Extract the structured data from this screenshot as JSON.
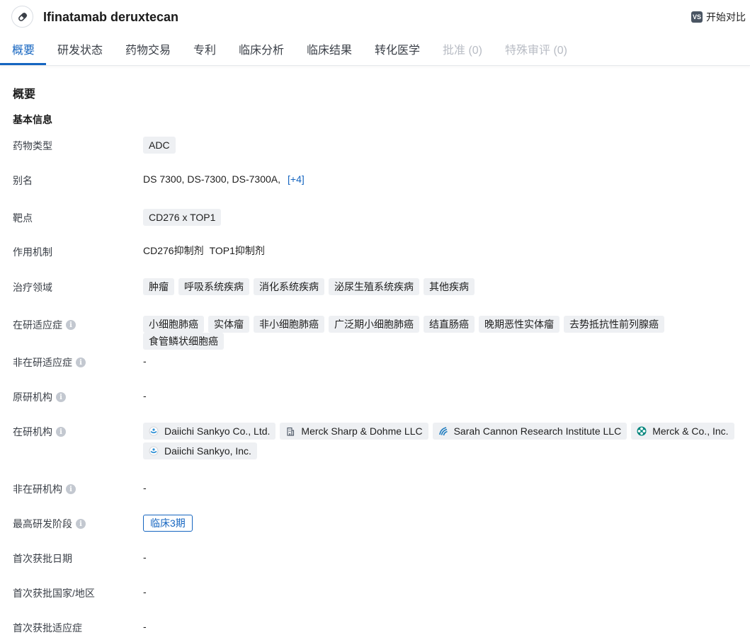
{
  "header": {
    "drug_name": "Ifinatamab deruxtecan",
    "compare_badge": "VS",
    "compare_label": "开始对比"
  },
  "tabs": [
    {
      "label": "概要",
      "state": "active"
    },
    {
      "label": "研发状态",
      "state": "normal"
    },
    {
      "label": "药物交易",
      "state": "normal"
    },
    {
      "label": "专利",
      "state": "normal"
    },
    {
      "label": "临床分析",
      "state": "normal"
    },
    {
      "label": "临床结果",
      "state": "normal"
    },
    {
      "label": "转化医学",
      "state": "normal"
    },
    {
      "label": "批准 (0)",
      "state": "disabled"
    },
    {
      "label": "特殊审评 (0)",
      "state": "disabled"
    }
  ],
  "section_title": "概要",
  "basic_info_title": "基本信息",
  "info_icon_glyph": "i",
  "rows": {
    "drug_type": {
      "label": "药物类型",
      "tags": [
        "ADC"
      ]
    },
    "aliases": {
      "label": "别名",
      "values": [
        "DS 7300,",
        "DS-7300,",
        "DS-7300A,"
      ],
      "more": "[+4]"
    },
    "target": {
      "label": "靶点",
      "tags": [
        "CD276 x TOP1"
      ]
    },
    "mechanism": {
      "label": "作用机制",
      "values": [
        "CD276抑制剂",
        "TOP1抑制剂"
      ]
    },
    "therapeutic_area": {
      "label": "治疗领域",
      "tags": [
        "肿瘤",
        "呼吸系统疾病",
        "消化系统疾病",
        "泌尿生殖系统疾病",
        "其他疾病"
      ]
    },
    "active_indications": {
      "label": "在研适应症",
      "tags": [
        "小细胞肺癌",
        "实体瘤",
        "非小细胞肺癌",
        "广泛期小细胞肺癌",
        "结直肠癌",
        "晚期恶性实体瘤",
        "去势抵抗性前列腺癌",
        "食管鳞状细胞癌"
      ]
    },
    "inactive_indications": {
      "label": "非在研适应症",
      "value": "-"
    },
    "originator": {
      "label": "原研机构",
      "value": "-"
    },
    "active_orgs": {
      "label": "在研机构",
      "orgs": [
        {
          "name": "Daiichi Sankyo Co., Ltd.",
          "logo": "daiichi-logo"
        },
        {
          "name": "Merck Sharp & Dohme LLC",
          "logo": "building-icon"
        },
        {
          "name": "Sarah Cannon Research Institute LLC",
          "logo": "sarah-cannon-logo"
        },
        {
          "name": "Merck & Co., Inc.",
          "logo": "merck-logo"
        },
        {
          "name": "Daiichi Sankyo, Inc.",
          "logo": "daiichi-logo"
        }
      ]
    },
    "inactive_orgs": {
      "label": "非在研机构",
      "value": "-"
    },
    "highest_phase": {
      "label": "最高研发阶段",
      "tag": "临床3期"
    },
    "first_approval_date": {
      "label": "首次获批日期",
      "value": "-"
    },
    "first_approval_region": {
      "label": "首次获批国家/地区",
      "value": "-"
    },
    "first_approval_indication": {
      "label": "首次获批适应症",
      "value": "-"
    }
  },
  "colors": {
    "accent": "#1565c0",
    "tag_bg": "#eef0f3",
    "disabled_tab": "#b8bcc4",
    "info_icon": "#c3c8d0"
  }
}
